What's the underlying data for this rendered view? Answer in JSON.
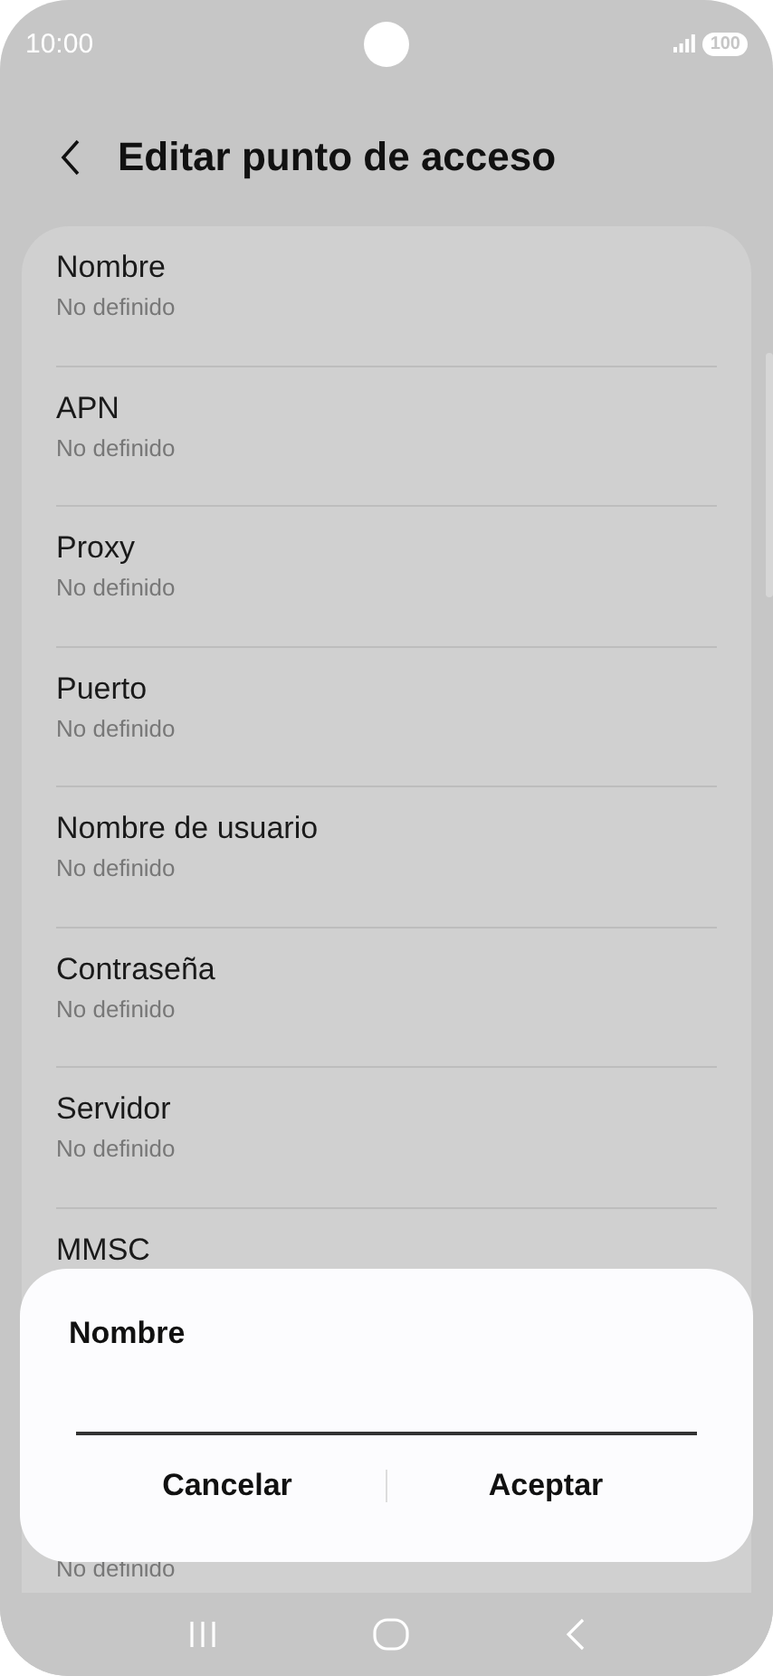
{
  "status_bar": {
    "time": "10:00",
    "battery": "100"
  },
  "header": {
    "title": "Editar punto de acceso"
  },
  "rows": [
    {
      "title": "Nombre",
      "value": "No definido"
    },
    {
      "title": "APN",
      "value": "No definido"
    },
    {
      "title": "Proxy",
      "value": "No definido"
    },
    {
      "title": "Puerto",
      "value": "No definido"
    },
    {
      "title": "Nombre de usuario",
      "value": "No definido"
    },
    {
      "title": "Contraseña",
      "value": "No definido"
    },
    {
      "title": "Servidor",
      "value": "No definido"
    },
    {
      "title": "MMSC"
    }
  ],
  "bottom_row_value": "No definido",
  "dialog": {
    "title": "Nombre",
    "buttons": [
      "Cancelar",
      "Aceptar"
    ]
  }
}
